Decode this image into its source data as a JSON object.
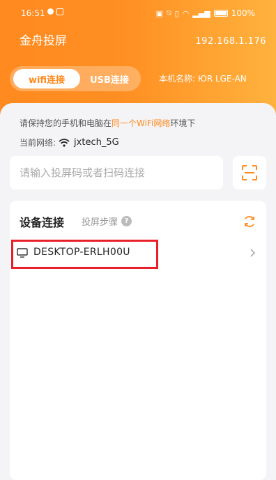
{
  "status_bar": {
    "time": "16:51",
    "battery": "100%"
  },
  "app": {
    "title": "金舟投屏",
    "ip": "192.168.1.176"
  },
  "tabs": [
    {
      "label": "wifi连接",
      "active": true
    },
    {
      "label": "USB连接",
      "active": false
    }
  ],
  "device_name": "本机名称: ЮR  LGE-AN",
  "tip": {
    "prefix": "请保持您的手机和电脑在",
    "highlight": "同一个WiFi网络",
    "suffix": "环境下"
  },
  "network": {
    "label": "当前网络:",
    "ssid": "jxtech_5G"
  },
  "search": {
    "placeholder": "请输入投屏码或者扫码连接"
  },
  "device_section": {
    "title": "设备连接",
    "steps_label": "投屏步骤",
    "help_glyph": "?",
    "devices": [
      {
        "name": "DESKTOP-ERLH00U",
        "icon": "monitor-icon"
      }
    ]
  },
  "colors": {
    "accent": "#ff8a1f",
    "highlight_box": "#e8202a"
  }
}
